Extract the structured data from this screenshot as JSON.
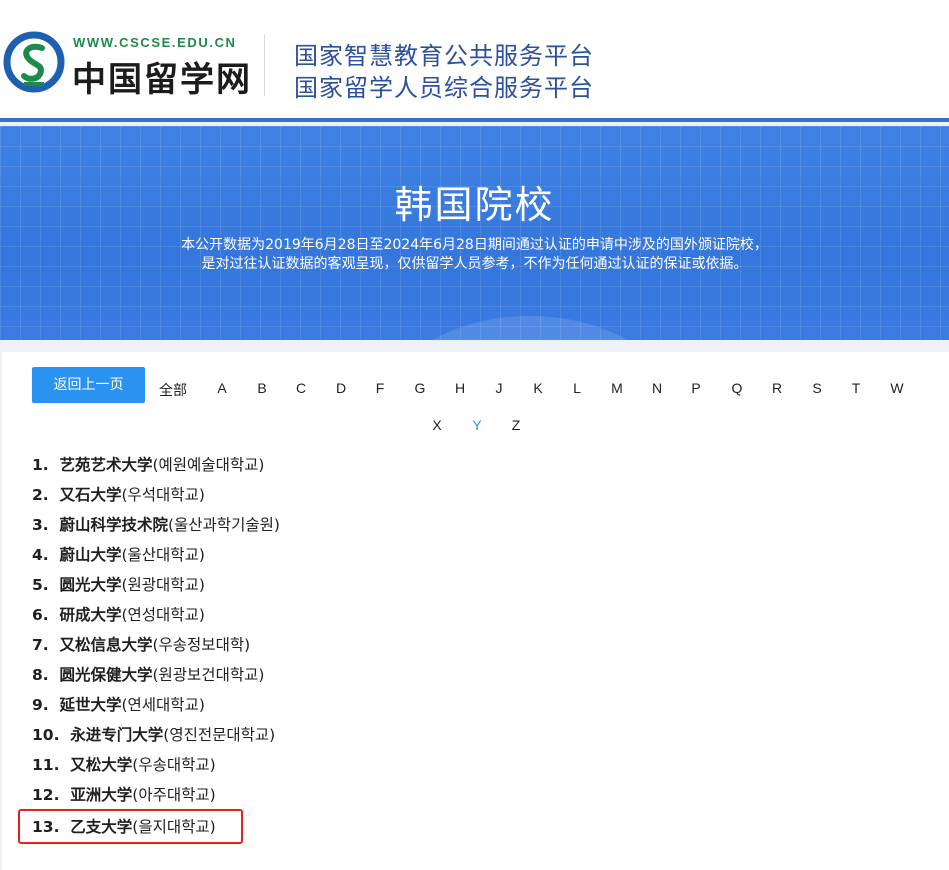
{
  "header": {
    "logo_url_text": "WWW.CSCSE.EDU.CN",
    "logo_name": "中国留学网",
    "platform_line1": "国家智慧教育公共服务平台",
    "platform_line2": "国家留学人员综合服务平台"
  },
  "banner": {
    "title": "韩国院校",
    "desc_line1": "本公开数据为2019年6月28日至2024年6月28日期间通过认证的申请中涉及的国外颁证院校，",
    "desc_line2": "是对过往认证数据的客观呈现，仅供留学人员参考，不作为任何通过认证的保证或依据。"
  },
  "nav": {
    "back_label": "返回上一页",
    "all_label": "全部",
    "letters": [
      "A",
      "B",
      "C",
      "D",
      "F",
      "G",
      "H",
      "J",
      "K",
      "L",
      "M",
      "N",
      "P",
      "Q",
      "R",
      "S",
      "T",
      "W",
      "X",
      "Y",
      "Z"
    ],
    "active_letter": "Y"
  },
  "schools": [
    {
      "num": "1.",
      "cn": "艺苑艺术大学",
      "kr": "(예원예술대학교)"
    },
    {
      "num": "2.",
      "cn": "又石大学",
      "kr": "(우석대학교)"
    },
    {
      "num": "3.",
      "cn": "蔚山科学技术院",
      "kr": "(울산과학기술원)"
    },
    {
      "num": "4.",
      "cn": "蔚山大学",
      "kr": "(울산대학교)"
    },
    {
      "num": "5.",
      "cn": "圆光大学",
      "kr": "(원광대학교)"
    },
    {
      "num": "6.",
      "cn": "研成大学",
      "kr": "(연성대학교)"
    },
    {
      "num": "7.",
      "cn": "又松信息大学",
      "kr": "(우송정보대학)"
    },
    {
      "num": "8.",
      "cn": "圆光保健大学",
      "kr": "(원광보건대학교)"
    },
    {
      "num": "9.",
      "cn": "延世大学",
      "kr": "(연세대학교)"
    },
    {
      "num": "10.",
      "cn": "永进专门大学",
      "kr": "(영진전문대학교)"
    },
    {
      "num": "11.",
      "cn": "又松大学",
      "kr": "(우송대학교)"
    },
    {
      "num": "12.",
      "cn": "亚洲大学",
      "kr": "(아주대학교)"
    },
    {
      "num": "13.",
      "cn": "乙支大学",
      "kr": "(을지대학교)"
    }
  ],
  "colors": {
    "banner_blue": "#3a7be0",
    "button_blue": "#2a93f2",
    "active_letter": "#3a8de8",
    "highlight_red": "#e2231a",
    "platform_text": "#2c4f9e"
  }
}
